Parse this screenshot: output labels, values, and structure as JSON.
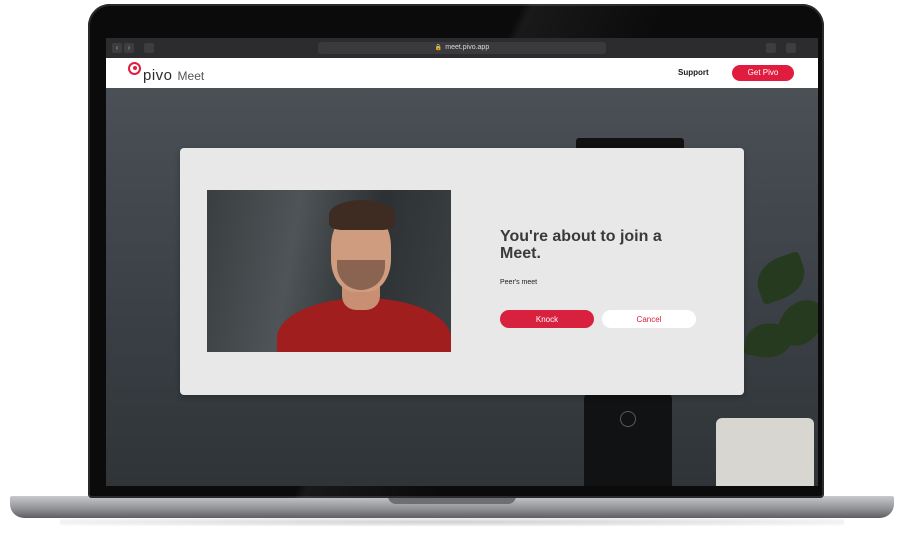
{
  "browser": {
    "url": "meet.pivo.app",
    "lock_icon": "lock-icon"
  },
  "header": {
    "logo_text": "pivo",
    "logo_sub": "Meet",
    "support_label": "Support",
    "cta_label": "Get Pivo",
    "accent_color": "#e11d3f"
  },
  "dialog": {
    "title": "You're about to join a Meet.",
    "meet_name": "Peer's meet",
    "knock_label": "Knock",
    "cancel_label": "Cancel"
  }
}
